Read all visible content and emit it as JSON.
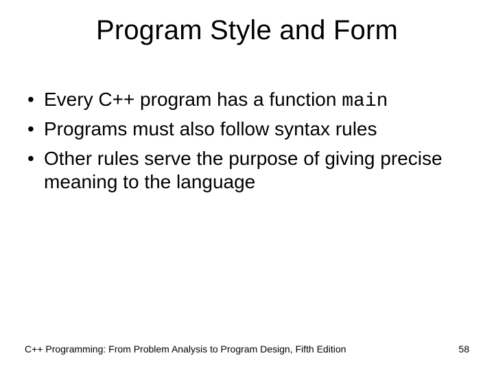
{
  "title": "Program Style and Form",
  "bullets": [
    {
      "pre": "Every C++ program has a function ",
      "mono": "main"
    },
    {
      "pre": "Programs must also follow syntax rules",
      "mono": ""
    },
    {
      "pre": "Other rules serve the purpose of giving precise meaning to the language",
      "mono": ""
    }
  ],
  "footer": {
    "source": "C++ Programming: From Problem Analysis to Program Design, Fifth Edition",
    "page": "58"
  }
}
